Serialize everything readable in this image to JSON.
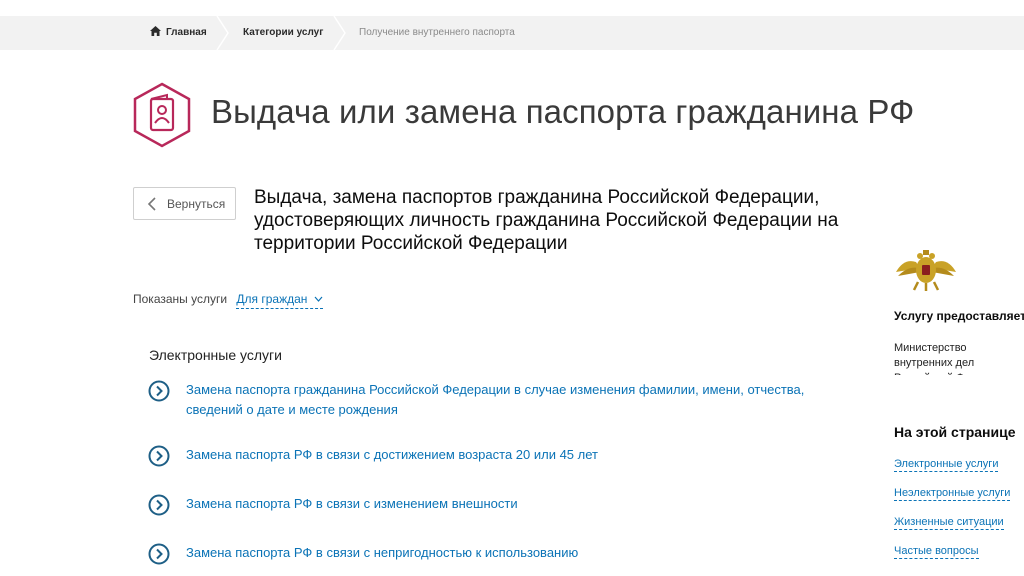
{
  "breadcrumb": {
    "home": "Главная",
    "category": "Категории услуг",
    "current": "Получение внутреннего паспорта"
  },
  "header": {
    "title": "Выдача или замена паспорта гражданина РФ",
    "icon": "passport-icon",
    "accent_color": "#b8285a"
  },
  "back_button": {
    "label": "Вернуться"
  },
  "service": {
    "title": "Выдача, замена паспортов гражданина Российской Федерации, удостоверяющих личность гражданина Российской Федерации на территории Российской Федерации"
  },
  "filter": {
    "label": "Показаны услуги",
    "selected": "Для граждан"
  },
  "electronic_services": {
    "heading": "Электронные услуги",
    "items": [
      {
        "label": "Замена паспорта гражданина Российской Федерации в случае изменения фамилии, имени, отчества, сведений о дате и месте рождения"
      },
      {
        "label": "Замена паспорта РФ в связи с достижением возраста 20 или 45 лет"
      },
      {
        "label": "Замена паспорта РФ в связи с изменением внешности"
      },
      {
        "label": "Замена паспорта РФ в связи с непригодностью к использованию"
      }
    ]
  },
  "sidebar": {
    "emblem": "mvd-emblem-icon",
    "provider_title": "Услугу предоставляет",
    "provider_name": "Министерство внутренних дел Российской Федерации",
    "on_page_title": "На этой странице",
    "links": [
      {
        "label": "Электронные услуги"
      },
      {
        "label": "Неэлектронные услуги"
      },
      {
        "label": "Жизненные ситуации"
      },
      {
        "label": "Частые вопросы"
      }
    ]
  },
  "colors": {
    "link": "#0b73b6",
    "breadcrumb_bg": "#f2f2f2",
    "title_text": "#3a3a3a"
  }
}
